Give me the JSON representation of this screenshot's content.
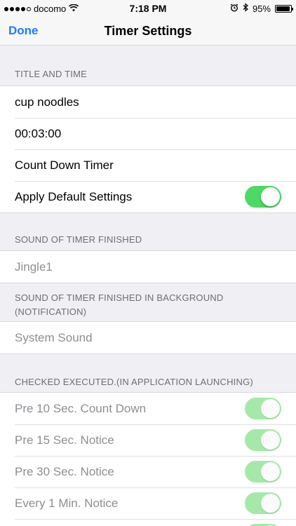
{
  "status_bar": {
    "carrier": "docomo",
    "time": "7:18 PM",
    "battery": "95%",
    "battery_level": 0.95
  },
  "nav": {
    "done_label": "Done",
    "title": "Timer Settings"
  },
  "sections": {
    "title_time": {
      "header": "TITLE AND TIME",
      "rows": [
        {
          "label": "cup noodles"
        },
        {
          "label": "00:03:00"
        },
        {
          "label": "Count Down Timer"
        },
        {
          "label": "Apply Default Settings",
          "toggle": true
        }
      ]
    },
    "sound_finished": {
      "header": "SOUND OF TIMER FINISHED",
      "value": "Jingle1"
    },
    "sound_background": {
      "header_line1": "SOUND OF TIMER FINISHED IN BACKGROUND",
      "header_line2": "(NOTIFICATION)",
      "value": "System Sound"
    },
    "checked_executed": {
      "header": "CHECKED EXECUTED.(IN APPLICATION LAUNCHING)",
      "rows": [
        {
          "label": "Pre 10 Sec. Count Down",
          "toggle": true
        },
        {
          "label": "Pre 15 Sec. Notice",
          "toggle": true
        },
        {
          "label": "Pre 30 Sec. Notice",
          "toggle": true
        },
        {
          "label": "Every 1 Min. Notice",
          "toggle": true
        }
      ]
    }
  },
  "colors": {
    "accent": "#157efb",
    "switch_on": "#4cd964",
    "switch_disabled": "#a4e9a8"
  }
}
